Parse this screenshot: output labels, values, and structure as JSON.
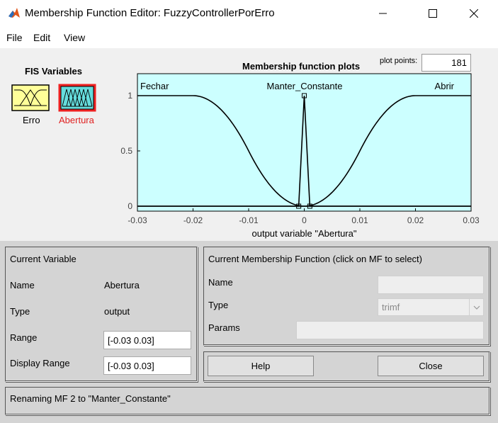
{
  "window": {
    "title": "Membership Function Editor: FuzzyControllerPorErro"
  },
  "menu": [
    "File",
    "Edit",
    "View"
  ],
  "fis": {
    "title": "FIS Variables",
    "input_label": "Erro",
    "output_label": "Abertura"
  },
  "plot": {
    "title": "Membership function plots",
    "plot_points_label": "plot points:",
    "plot_points_value": "181",
    "xlabel": "output variable \"Abertura\"",
    "mf_labels": [
      "Fechar",
      "Manter_Constante",
      "Abrir"
    ]
  },
  "chart_data": {
    "type": "line",
    "xlim": [
      -0.03,
      0.03
    ],
    "ylim": [
      0,
      1
    ],
    "x_ticks": [
      "-0.03",
      "-0.02",
      "-0.01",
      "0",
      "0.01",
      "0.02",
      "0.03"
    ],
    "y_ticks": [
      "0",
      "0.5",
      "1"
    ],
    "series": [
      {
        "name": "Fechar",
        "type": "zmf",
        "params": [
          -0.02,
          0.0
        ]
      },
      {
        "name": "Manter_Constante",
        "type": "trimf",
        "params": [
          -0.001,
          0.0,
          0.001
        ]
      },
      {
        "name": "Abrir",
        "type": "smf",
        "params": [
          0.0,
          0.02
        ]
      }
    ],
    "background": "#ccffff",
    "line_color": "#000000"
  },
  "current_variable": {
    "title": "Current Variable",
    "name_label": "Name",
    "name_value": "Abertura",
    "type_label": "Type",
    "type_value": "output",
    "range_label": "Range",
    "range_value": "[-0.03 0.03]",
    "display_range_label": "Display Range",
    "display_range_value": "[-0.03 0.03]"
  },
  "current_mf": {
    "title": "Current Membership Function (click on MF to select)",
    "name_label": "Name",
    "name_value": "",
    "type_label": "Type",
    "type_value": "trimf",
    "params_label": "Params",
    "params_value": ""
  },
  "buttons": {
    "help": "Help",
    "close": "Close"
  },
  "status": "Renaming MF 2 to \"Manter_Constante\""
}
